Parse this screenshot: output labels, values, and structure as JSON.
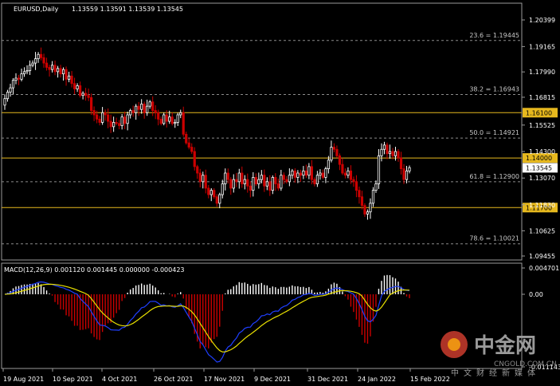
{
  "header": {
    "symbol": "EURUSD,Daily",
    "ohlc": "1.13559 1.13591 1.13539 1.13545"
  },
  "macd_header": "MACD(12,26,9) 0.001120 0.001445 0.000000 -0.000423",
  "watermark": {
    "brand": "中金网",
    "site": "CNGOLD.COM.CN",
    "slogan": "中文财经新媒体",
    "colors": {
      "outer": "#c0392b",
      "inner": "#f39c12"
    }
  },
  "colors": {
    "bull": "#ffffff",
    "bear": "#cc0000",
    "fib": "#8c8c8c",
    "hline": "#e6b81e",
    "current_tag": "#ffffff",
    "macd_line": "#1f3fff",
    "signal_line": "#e8e000",
    "hist_pos": "#ffffff",
    "hist_neg": "#cc0000"
  },
  "chart_data": {
    "type": "candlestick",
    "price_axis": {
      "ticks": [
        "1.20399",
        "1.19165",
        "1.17990",
        "1.16815",
        "1.15525",
        "1.14300",
        "1.13070",
        "1.11830",
        "1.10625",
        "1.09455"
      ],
      "tick_values": [
        1.20399,
        1.19165,
        1.1799,
        1.16815,
        1.15525,
        1.143,
        1.1307,
        1.1183,
        1.10625,
        1.09455
      ]
    },
    "fib_levels": [
      {
        "label": "23.6 = 1.19445",
        "value": 1.19445
      },
      {
        "label": "38.2 = 1.16943",
        "value": 1.16943
      },
      {
        "label": "50.0 = 1.14921",
        "value": 1.14921
      },
      {
        "label": "61.8 = 1.12900",
        "value": 1.129
      },
      {
        "label": "78.6 = 1.10021",
        "value": 1.10021
      }
    ],
    "horizontal_levels": [
      {
        "label": "1.16100",
        "value": 1.161
      },
      {
        "label": "1.14000",
        "value": 1.14
      },
      {
        "label": "1.11700",
        "value": 1.117
      }
    ],
    "current_price": {
      "label": "1.13545",
      "value": 1.13545
    },
    "date_labels": [
      "19 Aug 2021",
      "10 Sep 2021",
      "4 Oct 2021",
      "26 Oct 2021",
      "17 Nov 2021",
      "9 Dec 2021",
      "31 Dec 2021",
      "24 Jan 2022",
      "15 Feb 2022"
    ],
    "closes": [
      1.1675,
      1.1705,
      1.1725,
      1.176,
      1.177,
      1.1765,
      1.179,
      1.18,
      1.1805,
      1.183,
      1.184,
      1.186,
      1.188,
      1.1865,
      1.184,
      1.182,
      1.181,
      1.183,
      1.18,
      1.1815,
      1.179,
      1.181,
      1.1765,
      1.178,
      1.1745,
      1.172,
      1.1735,
      1.169,
      1.17,
      1.169,
      1.168,
      1.162,
      1.16,
      1.158,
      1.1565,
      1.161,
      1.16,
      1.157,
      1.1545,
      1.1565,
      1.156,
      1.155,
      1.159,
      1.156,
      1.16,
      1.162,
      1.161,
      1.164,
      1.1625,
      1.165,
      1.161,
      1.164,
      1.166,
      1.162,
      1.161,
      1.158,
      1.156,
      1.16,
      1.157,
      1.159,
      1.156,
      1.1565,
      1.16,
      1.161,
      1.151,
      1.147,
      1.145,
      1.143,
      1.136,
      1.133,
      1.129,
      1.132,
      1.126,
      1.123,
      1.125,
      1.122,
      1.119,
      1.123,
      1.128,
      1.133,
      1.13,
      1.126,
      1.13,
      1.129,
      1.133,
      1.128,
      1.13,
      1.127,
      1.125,
      1.131,
      1.128,
      1.13,
      1.132,
      1.127,
      1.129,
      1.125,
      1.131,
      1.128,
      1.126,
      1.132,
      1.13,
      1.129,
      1.132,
      1.134,
      1.131,
      1.133,
      1.132,
      1.134,
      1.132,
      1.136,
      1.13,
      1.128,
      1.132,
      1.133,
      1.131,
      1.135,
      1.139,
      1.145,
      1.144,
      1.141,
      1.137,
      1.133,
      1.132,
      1.134,
      1.13,
      1.129,
      1.125,
      1.122,
      1.118,
      1.114,
      1.115,
      1.119,
      1.125,
      1.128,
      1.141,
      1.144,
      1.146,
      1.142,
      1.143,
      1.141,
      1.143,
      1.14,
      1.135,
      1.13,
      1.134,
      1.1355
    ],
    "macd": {
      "scale_labels": [
        "0.004701",
        "0.00",
        "-0.011143"
      ],
      "scale_values": [
        0.004701,
        0.0,
        -0.011143
      ]
    }
  }
}
